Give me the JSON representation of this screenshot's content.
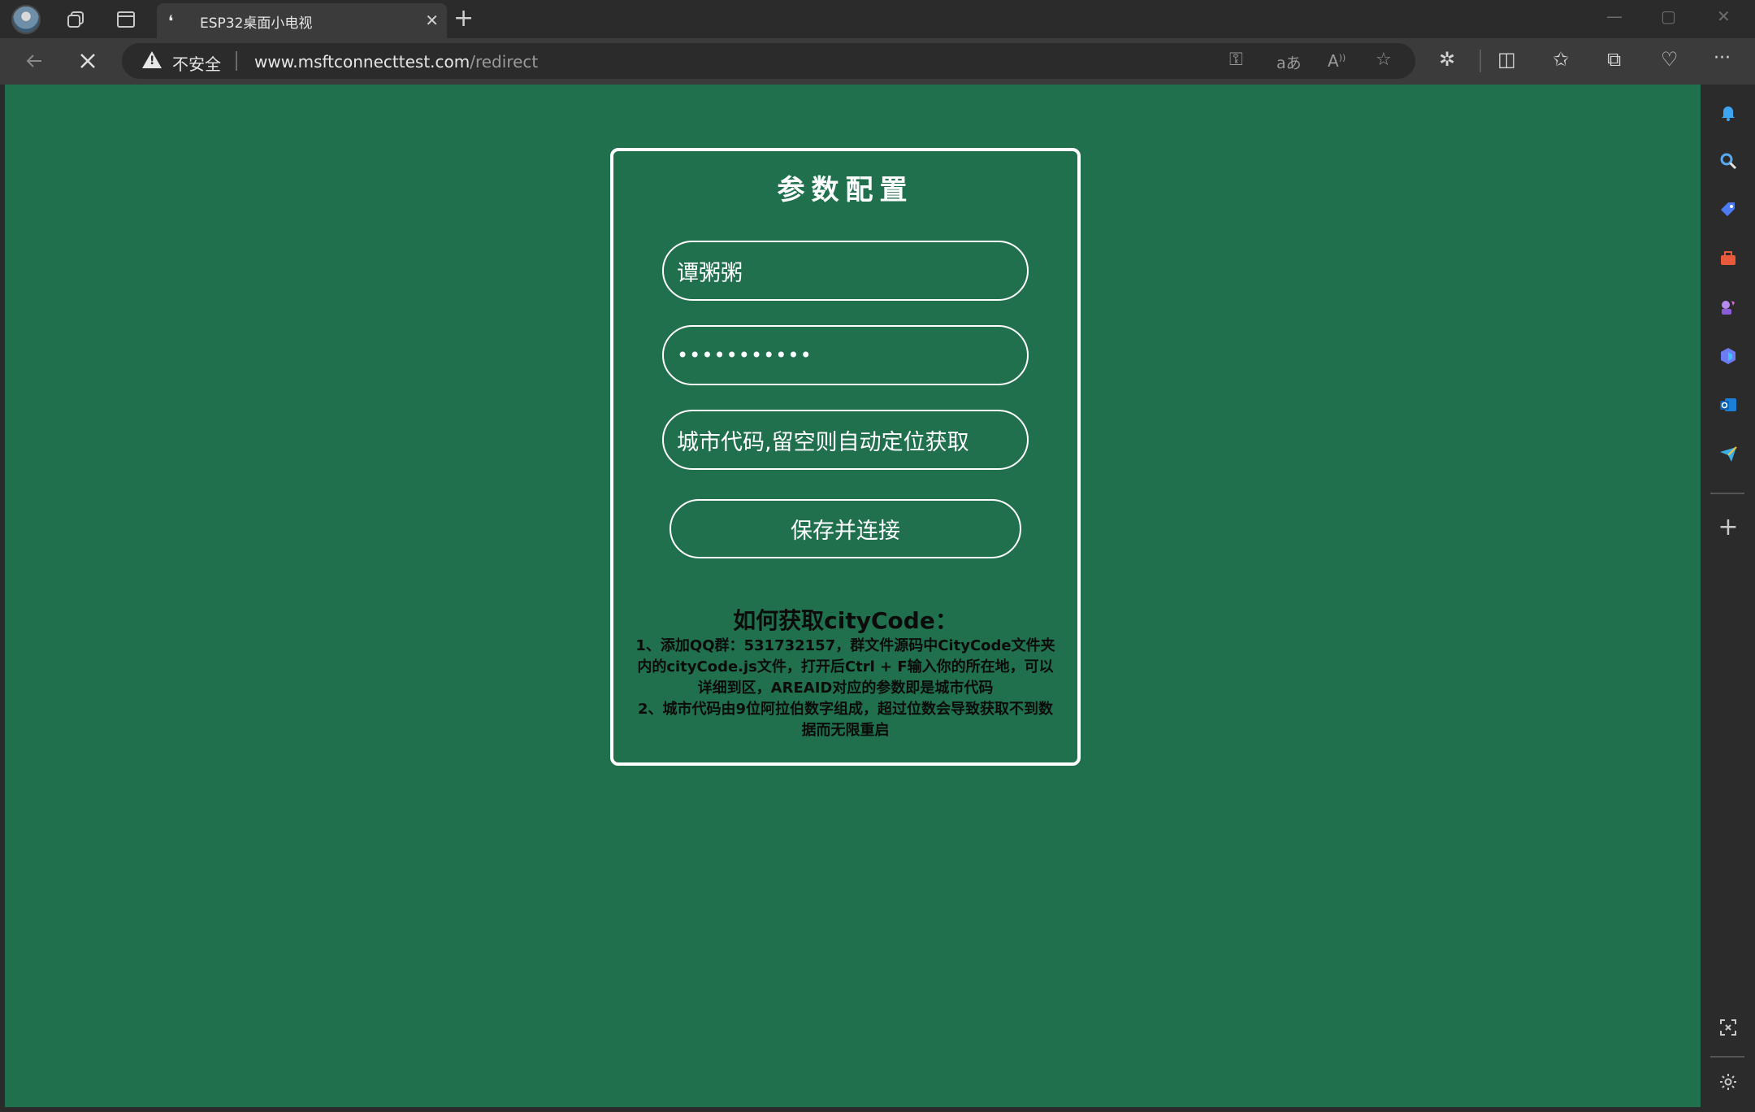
{
  "browser": {
    "tab": {
      "title": "ESP32桌面小电视"
    },
    "address": {
      "security_label": "不安全",
      "url_host": "www.msftconnecttest.com",
      "url_path": "/redirect"
    }
  },
  "form": {
    "title": "参数配置",
    "name_value": "谭粥粥",
    "password_value": "•••••••••••",
    "citycode_placeholder": "城市代码,留空则自动定位获取",
    "submit_label": "保存并连接"
  },
  "help": {
    "title": "如何获取cityCode：",
    "line1": "1、添加QQ群：531732157，群文件源码中CityCode文件夹内的cityCode.js文件，打开后Ctrl + F输入你的所在地，可以详细到区，AREAID对应的参数即是城市代码",
    "line2": "2、城市代码由9位阿拉伯数字组成，超过位数会导致获取不到数据而无限重启"
  },
  "colors": {
    "page_bg": "#20704d",
    "chrome_dark": "#2b2b2b",
    "chrome_mid": "#3b3b3b"
  }
}
